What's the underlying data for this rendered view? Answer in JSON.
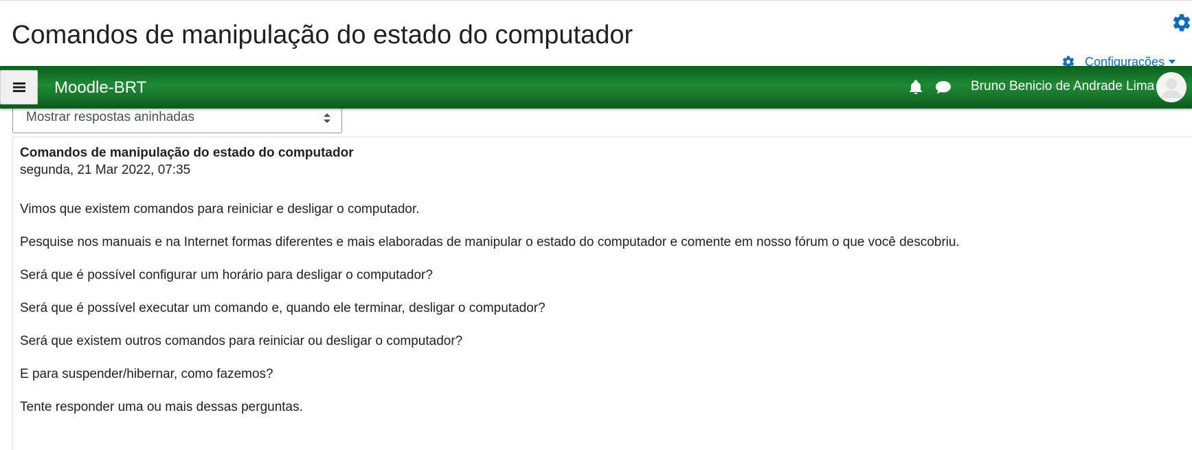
{
  "page": {
    "title": "Comandos de manipulação do estado do computador",
    "settings_label": "Configurações"
  },
  "navbar": {
    "brand": "Moodle-BRT",
    "user_name": "Bruno Benicio de Andrade Lima",
    "bg_color": "#1a7f2e",
    "icons": [
      "menu-icon",
      "bell-icon",
      "chat-icon",
      "avatar"
    ]
  },
  "display_mode": {
    "selected": "Mostrar respostas aninhadas"
  },
  "post": {
    "subject": "Comandos de manipulação do estado do computador",
    "date": "segunda, 21 Mar 2022, 07:35",
    "paragraphs": [
      "Vimos que existem comandos para reiniciar e desligar o computador.",
      "Pesquise nos manuais e na Internet formas diferentes e mais elaboradas de manipular o estado do computador e comente em nosso fórum o que você descobriu.",
      "Será que é possível configurar um horário para desligar o computador?",
      "Será que é possível executar um comando e, quando ele terminar, desligar o computador?",
      "Será que existem outros comandos para reiniciar ou desligar o computador?",
      "E para suspender/hibernar, como fazemos?",
      "Tente responder uma ou mais dessas perguntas."
    ]
  },
  "colors": {
    "accent": "#0f6cbf",
    "text": "#1d2125"
  }
}
